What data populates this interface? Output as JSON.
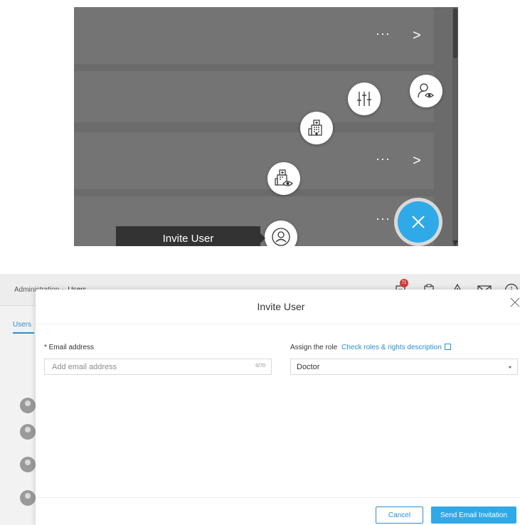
{
  "fab_menu": {
    "tooltip_label": "Invite User",
    "more_label": "···",
    "chevron": ">",
    "items": [
      {
        "icon": "user-eye-icon"
      },
      {
        "icon": "sliders-icon"
      },
      {
        "icon": "hospital-icon"
      },
      {
        "icon": "hospital-eye-icon"
      },
      {
        "icon": "user-circle-icon"
      }
    ],
    "close_icon": "close-icon",
    "accent_color": "#2fa9e8"
  },
  "topbar": {
    "breadcrumb": [
      "Administration",
      "Users"
    ],
    "notification_count": "71",
    "icons": [
      "notification-icon",
      "clipboard-check-icon",
      "warning-icon",
      "mail-icon",
      "info-icon"
    ]
  },
  "background": {
    "tab_label": "Users"
  },
  "modal": {
    "title": "Invite User",
    "email": {
      "label": "* Email address",
      "placeholder": "Add email address",
      "counter": "0/70"
    },
    "role": {
      "label": "Assign the role",
      "link_text": "Check roles & rights description",
      "selected": "Doctor"
    },
    "buttons": {
      "cancel": "Cancel",
      "send": "Send Email Invitation"
    }
  }
}
